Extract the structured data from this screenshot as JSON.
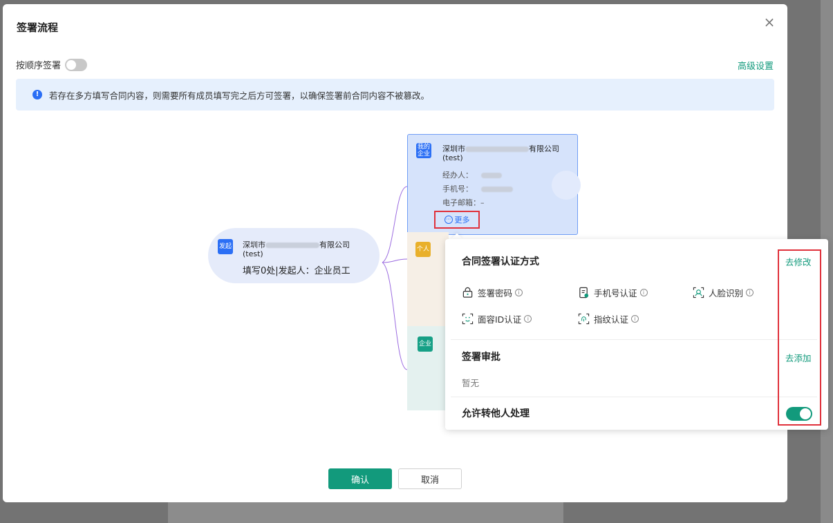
{
  "dialog": {
    "title": "签署流程",
    "close_glyph": "×",
    "order_sign_label": "按顺序签署",
    "order_sign_enabled": false,
    "advanced_settings": "高级设置",
    "notice_icon": "!",
    "notice": "若存在多方填写合同内容，则需要所有成员填写完之后方可签署，以确保签署前合同内容不被篡改。"
  },
  "initiator": {
    "tag": "发起",
    "name_prefix": "深圳市",
    "name_suffix": "有限公司",
    "name_sub": "(test)",
    "detail": "填写0处|发起人：企业员工"
  },
  "my_company": {
    "tag_line1": "我的",
    "tag_line2": "企业",
    "name_prefix": "深圳市",
    "name_suffix": "有限公司",
    "name_sub": "(test)",
    "handler_label": "经办人：",
    "phone_label": "手机号：",
    "email_label": "电子邮箱：",
    "email_value": "–",
    "more_icon": "···",
    "more_label": "更多"
  },
  "person_card": {
    "tag": "个人"
  },
  "company_card": {
    "tag": "企业"
  },
  "popover": {
    "auth": {
      "title": "合同签署认证方式",
      "edit_link": "去修改",
      "info_glyph": "i",
      "methods": [
        {
          "label": "签署密码",
          "icon": "lock-icon"
        },
        {
          "label": "手机号认证",
          "icon": "phone-check-icon"
        },
        {
          "label": "人脸识别",
          "icon": "face-icon"
        },
        {
          "label": "面容ID认证",
          "icon": "face-id-icon"
        },
        {
          "label": "指纹认证",
          "icon": "fingerprint-icon"
        }
      ]
    },
    "approval": {
      "title": "签署审批",
      "add_link": "去添加",
      "empty": "暂无"
    },
    "transfer": {
      "title": "允许转他人处理",
      "enabled": true
    }
  },
  "footer": {
    "confirm": "确认",
    "cancel": "取消"
  },
  "colors": {
    "accent": "#129a7c",
    "blue": "#2b6ff5",
    "highlight_box": "#e0303a"
  }
}
